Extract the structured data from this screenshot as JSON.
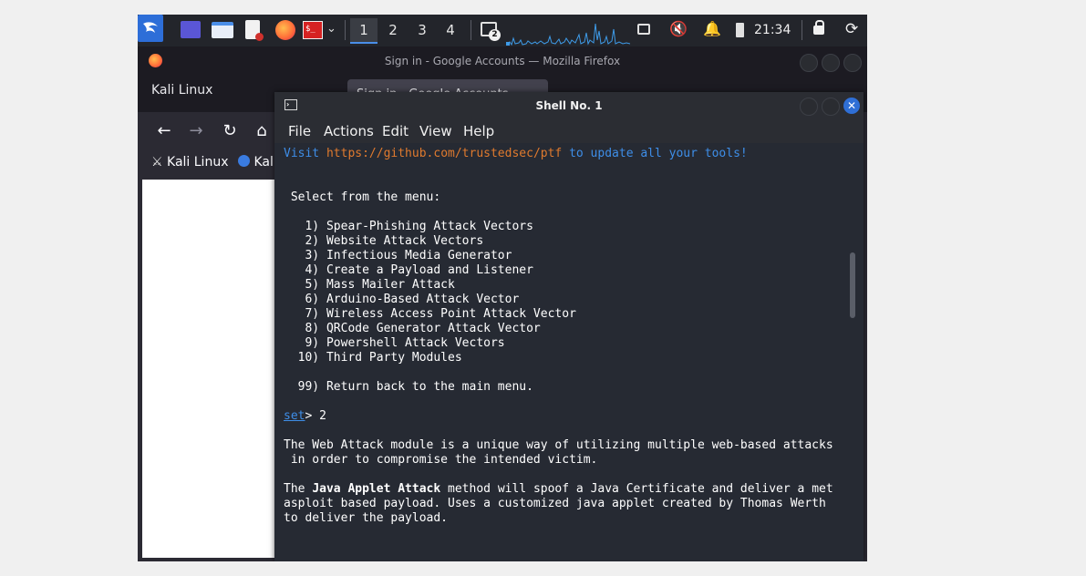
{
  "taskbar": {
    "workspaces": [
      "1",
      "2",
      "3",
      "4"
    ],
    "badge": "2",
    "clock": "21:34"
  },
  "firefox": {
    "window_title": "Sign in - Google Accounts — Mozilla Firefox",
    "tabs": {
      "kali_tab": "Kali Linux",
      "active_tab": "Sign in - Google Accounts"
    },
    "bookmarks": [
      "Kali Linux",
      "Kali"
    ]
  },
  "terminal": {
    "title": "Shell No. 1",
    "menu": [
      "File",
      "Actions",
      "Edit",
      "View",
      "Help"
    ],
    "update_line": {
      "prefix": "Visit ",
      "url": "https://github.com/trustedsec/ptf",
      "suffix": " to update all your tools!"
    },
    "select_prompt": " Select from the menu:",
    "menu_items": [
      "   1) Spear-Phishing Attack Vectors",
      "   2) Website Attack Vectors",
      "   3) Infectious Media Generator",
      "   4) Create a Payload and Listener",
      "   5) Mass Mailer Attack",
      "   6) Arduino-Based Attack Vector",
      "   7) Wireless Access Point Attack Vector",
      "   8) QRCode Generator Attack Vector",
      "   9) Powershell Attack Vectors",
      "  10) Third Party Modules"
    ],
    "return_item": "  99) Return back to the main menu.",
    "prompt_word": "set",
    "prompt_rest": "> 2",
    "web_attack_line1": "The Web Attack module is a unique way of utilizing multiple web-based attacks",
    "web_attack_line2": " in order to compromise the intended victim.",
    "java": {
      "prefix": "The ",
      "bold": "Java Applet Attack",
      "suffix": " method will spoof a Java Certificate and deliver a met",
      "line2": "asploit based payload. Uses a customized java applet created by Thomas Werth",
      "line3": "to deliver the payload."
    }
  }
}
